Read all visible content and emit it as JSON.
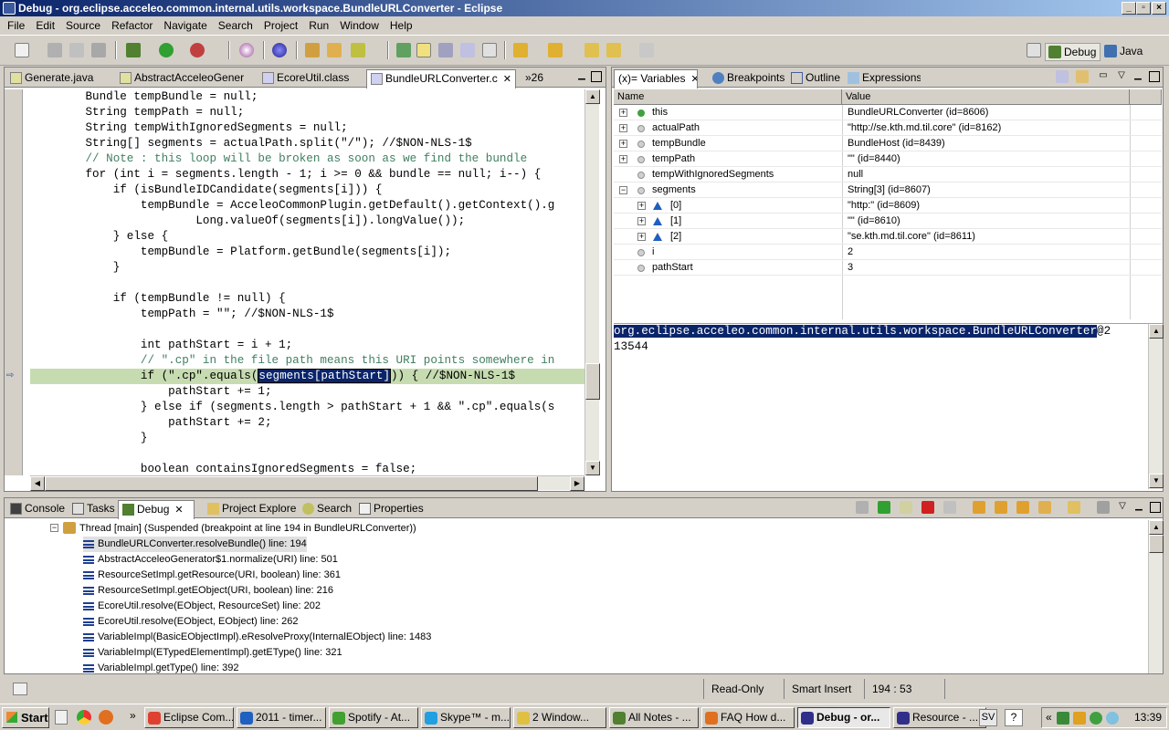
{
  "window": {
    "title": "Debug - org.eclipse.acceleo.common.internal.utils.workspace.BundleURLConverter - Eclipse"
  },
  "menu": [
    "File",
    "Edit",
    "Source",
    "Refactor",
    "Navigate",
    "Search",
    "Project",
    "Run",
    "Window",
    "Help"
  ],
  "perspectives": {
    "debug": "Debug",
    "java": "Java"
  },
  "editor_tabs": [
    {
      "label": "Generate.java"
    },
    {
      "label": "AbstractAcceleoGener"
    },
    {
      "label": "EcoreUtil.class"
    },
    {
      "label": "BundleURLConverter.c"
    }
  ],
  "editor_overflow": "»26",
  "code_lines": [
    "        Bundle tempBundle = null;",
    "        String tempPath = null;",
    "        String tempWithIgnoredSegments = null;",
    "        String[] segments = actualPath.split(\"/\"); //$NON-NLS-1$",
    "        // Note : this loop will be broken as soon as we find the bundle",
    "        for (int i = segments.length - 1; i >= 0 && bundle == null; i--) {",
    "            if (isBundleIDCandidate(segments[i])) {",
    "                tempBundle = AcceleoCommonPlugin.getDefault().getContext().g",
    "                        Long.valueOf(segments[i]).longValue());",
    "            } else {",
    "                tempBundle = Platform.getBundle(segments[i]);",
    "            }",
    "",
    "            if (tempBundle != null) {",
    "                tempPath = \"\"; //$NON-NLS-1$",
    "",
    "                int pathStart = i + 1;",
    "                // \".cp\" in the file path means this URI points somewhere in",
    "                if (\".cp\".equals(",
    "                    pathStart += 1;",
    "                } else if (segments.length > pathStart + 1 && \".cp\".equals(s",
    "                    pathStart += 2;",
    "                }",
    "",
    "                boolean containsIgnoredSegments = false;"
  ],
  "current_line_selection": "segments[pathStart]",
  "current_line_tail": ")) { //$NON-NLS-1$",
  "var_tabs": [
    {
      "label": "(x)= Variables"
    },
    {
      "label": "Breakpoints"
    },
    {
      "label": "Outline"
    },
    {
      "label": "Expressions"
    }
  ],
  "var_columns": {
    "name": "Name",
    "value": "Value"
  },
  "variables": [
    {
      "expander": "+",
      "name": "this",
      "value": "BundleURLConverter  (id=8606)"
    },
    {
      "expander": "+",
      "name": "actualPath",
      "value": "\"http://se.kth.md.til.core\" (id=8162)"
    },
    {
      "expander": "+",
      "name": "tempBundle",
      "value": "BundleHost  (id=8439)"
    },
    {
      "expander": "+",
      "name": "tempPath",
      "value": "\"\" (id=8440)"
    },
    {
      "expander": "",
      "name": "tempWithIgnoredSegments",
      "value": "null"
    },
    {
      "expander": "−",
      "name": "segments",
      "value": "String[3]  (id=8607)"
    },
    {
      "expander": "+",
      "name": "[0]",
      "value": "\"http:\" (id=8609)"
    },
    {
      "expander": "+",
      "name": "[1]",
      "value": "\"\" (id=8610)"
    },
    {
      "expander": "+",
      "name": "[2]",
      "value": "\"se.kth.md.til.core\" (id=8611)"
    },
    {
      "expander": "",
      "name": "i",
      "value": "2"
    },
    {
      "expander": "",
      "name": "pathStart",
      "value": "3"
    }
  ],
  "detail": {
    "selected": "org.eclipse.acceleo.common.internal.utils.workspace.BundleURLConverter",
    "rest": "@2",
    "line2": "13544"
  },
  "bottom_tabs": [
    {
      "label": "Console"
    },
    {
      "label": "Tasks"
    },
    {
      "label": "Debug"
    },
    {
      "label": "Project Explorer"
    },
    {
      "label": "Search"
    },
    {
      "label": "Properties"
    }
  ],
  "thread": "Thread [main] (Suspended (breakpoint at line 194 in BundleURLConverter))",
  "frames": [
    "BundleURLConverter.resolveBundle() line: 194",
    "AbstractAcceleoGenerator$1.normalize(URI) line: 501",
    "ResourceSetImpl.getResource(URI, boolean) line: 361",
    "ResourceSetImpl.getEObject(URI, boolean) line: 216",
    "EcoreUtil.resolve(EObject, ResourceSet) line: 202",
    "EcoreUtil.resolve(EObject, EObject) line: 262",
    "VariableImpl(BasicEObjectImpl).eResolveProxy(InternalEObject) line: 1483",
    "VariableImpl(ETypedElementImpl).getEType() line: 321",
    "VariableImpl.getType() line: 392"
  ],
  "status": {
    "mode": "Read-Only",
    "insert": "Smart Insert",
    "pos": "194 : 53"
  },
  "taskbar": {
    "start": "Start",
    "items": [
      {
        "label": "Eclipse Com...",
        "color": "#e04030"
      },
      {
        "label": "2011 - timer...",
        "color": "#2060c0"
      },
      {
        "label": "Spotify - At...",
        "color": "#40a030"
      },
      {
        "label": "Skype™ - m...",
        "color": "#20a0e0"
      },
      {
        "label": "2 Window...",
        "color": "#e0c040"
      },
      {
        "label": "All Notes - ...",
        "color": "#508030"
      },
      {
        "label": "FAQ How d...",
        "color": "#e07020"
      },
      {
        "label": "Debug - or...",
        "color": "#30308a"
      },
      {
        "label": "Resource - ...",
        "color": "#30308a"
      }
    ],
    "lang": "SV",
    "clock": "13:39"
  }
}
